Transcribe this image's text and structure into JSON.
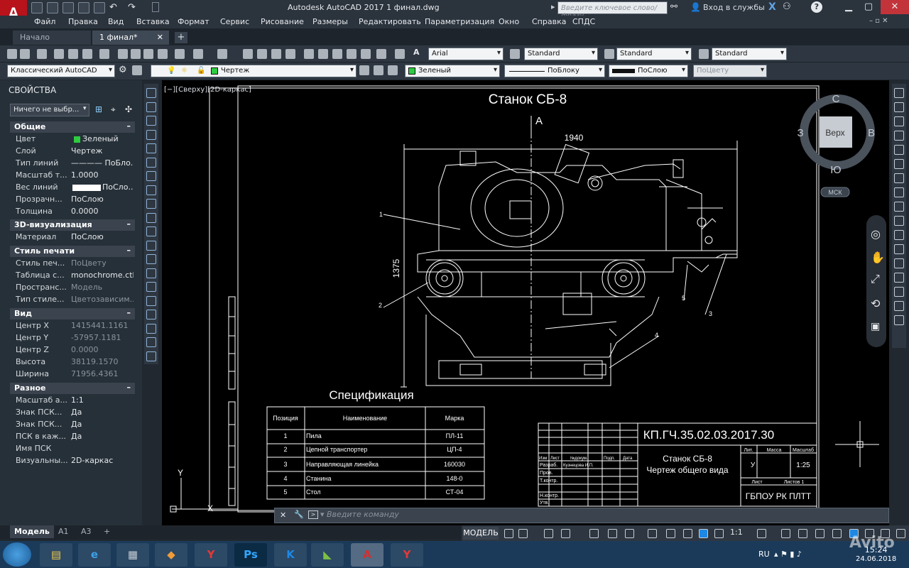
{
  "window": {
    "title": "Autodesk AutoCAD 2017   1 финал.dwg",
    "search_placeholder": "Введите ключевое слово/фразу",
    "login": "Вход в службы"
  },
  "menu": [
    "Файл",
    "Правка",
    "Вид",
    "Вставка",
    "Формат",
    "Сервис",
    "Рисование",
    "Размеры",
    "Редактировать",
    "Параметризация",
    "Окно",
    "Справка",
    "СПДС"
  ],
  "tabs": {
    "start": "Начало",
    "file": "1 финал*",
    "add": "+"
  },
  "toolbar": {
    "font": "Arial",
    "dimstyle": "Standard",
    "textstyle": "Standard",
    "mleaderstyle": "Standard",
    "workspace": "Классический AutoCAD",
    "layer": "Чертеж",
    "color": "Зеленый",
    "linetype": "ПоБлоку",
    "lineweight": "ПоСлою",
    "plotstyle": "ПоЦвету"
  },
  "properties": {
    "title": "СВОЙСТВА",
    "selection": "Ничего не выбр...",
    "sections": {
      "general": "Общие",
      "viz3d": "3D-визуализация",
      "plot": "Стиль печати",
      "view": "Вид",
      "misc": "Разное"
    },
    "general": [
      {
        "label": "Цвет",
        "value": "Зеленый"
      },
      {
        "label": "Слой",
        "value": "Чертеж"
      },
      {
        "label": "Тип линий",
        "value": "———— ПоБло..."
      },
      {
        "label": "Масштаб т...",
        "value": "1.0000"
      },
      {
        "label": "Вес линий",
        "value": "ПоСло..."
      },
      {
        "label": "Прозрачн...",
        "value": "ПоСлою"
      },
      {
        "label": "Толщина",
        "value": "0.0000"
      }
    ],
    "viz3d": [
      {
        "label": "Материал",
        "value": "ПоСлою"
      }
    ],
    "plot": [
      {
        "label": "Стиль печ...",
        "value": "ПоЦвету"
      },
      {
        "label": "Таблица с...",
        "value": "monochrome.ctb"
      },
      {
        "label": "Пространс...",
        "value": "Модель"
      },
      {
        "label": "Тип стиле...",
        "value": "Цветозависим..."
      }
    ],
    "view": [
      {
        "label": "Центр X",
        "value": "1415441.1161"
      },
      {
        "label": "Центр Y",
        "value": "-57957.1181"
      },
      {
        "label": "Центр Z",
        "value": "0.0000"
      },
      {
        "label": "Высота",
        "value": "38119.1570"
      },
      {
        "label": "Ширина",
        "value": "71956.4361"
      }
    ],
    "misc": [
      {
        "label": "Масштаб а...",
        "value": "1:1"
      },
      {
        "label": "Знак ПСК...",
        "value": "Да"
      },
      {
        "label": "Знак ПСК...",
        "value": "Да"
      },
      {
        "label": "ПСК в каж...",
        "value": "Да"
      },
      {
        "label": "Имя ПСК",
        "value": ""
      },
      {
        "label": "Визуальны...",
        "value": "2D-каркас"
      }
    ]
  },
  "viewport": {
    "label": "[−][Сверху][2D-каркас]"
  },
  "drawing": {
    "title": "Станок СБ-8",
    "section_mark": "А",
    "dim_width": "1940",
    "dim_height": "1375",
    "callouts": [
      "1",
      "2",
      "3",
      "4",
      "5"
    ],
    "spec_title": "Спецификация",
    "spec_headers": [
      "Позиция",
      "Наименование",
      "Марка"
    ],
    "spec_rows": [
      [
        "1",
        "Пила",
        "ПЛ-11"
      ],
      [
        "2",
        "Цепной транспортер",
        "ЦП-4"
      ],
      [
        "3",
        "Направляющая линейка",
        "160030"
      ],
      [
        "4",
        "Станина",
        "148-0"
      ],
      [
        "5",
        "Стол",
        "СТ-04"
      ]
    ],
    "stamp": {
      "code": "КП.ГЧ.35.02.03.2017.30",
      "name1": "Станок СБ-8",
      "name2": "Чертеж общего вида",
      "col_izm": "Изм",
      "col_list": "Лист",
      "col_doc": "№докум.",
      "col_sign": "Подп.",
      "col_date": "Дата",
      "razrab": "Разраб.",
      "author": "Кузнецова И.П.",
      "prov": "Пров.",
      "tkontr": "Т.контр.",
      "nkontr": "Н.контр.",
      "utv": "Утв.",
      "lit": "Лит.",
      "mass": "Масса",
      "scale_h": "Масштаб",
      "lit_val": "У",
      "scale_val": "1:25",
      "sheet": "Лист",
      "sheets": "Листов  1",
      "org": "ГБПОУ РК ПЛТТ"
    },
    "viewcube": {
      "n": "С",
      "s": "Ю",
      "w": "З",
      "e": "В",
      "face": "Верх",
      "ucs": "МСК"
    },
    "ucs_y": "Y",
    "ucs_x": "X"
  },
  "command": {
    "placeholder": "Введите команду"
  },
  "layouts": [
    "Модель",
    "A1",
    "A3",
    "+"
  ],
  "status": {
    "model": "МОДЕЛЬ",
    "scale": "1:1"
  },
  "taskbar": {
    "lang": "RU",
    "time": "15:24",
    "date": "24.06.2018",
    "watermark": "Avito"
  }
}
